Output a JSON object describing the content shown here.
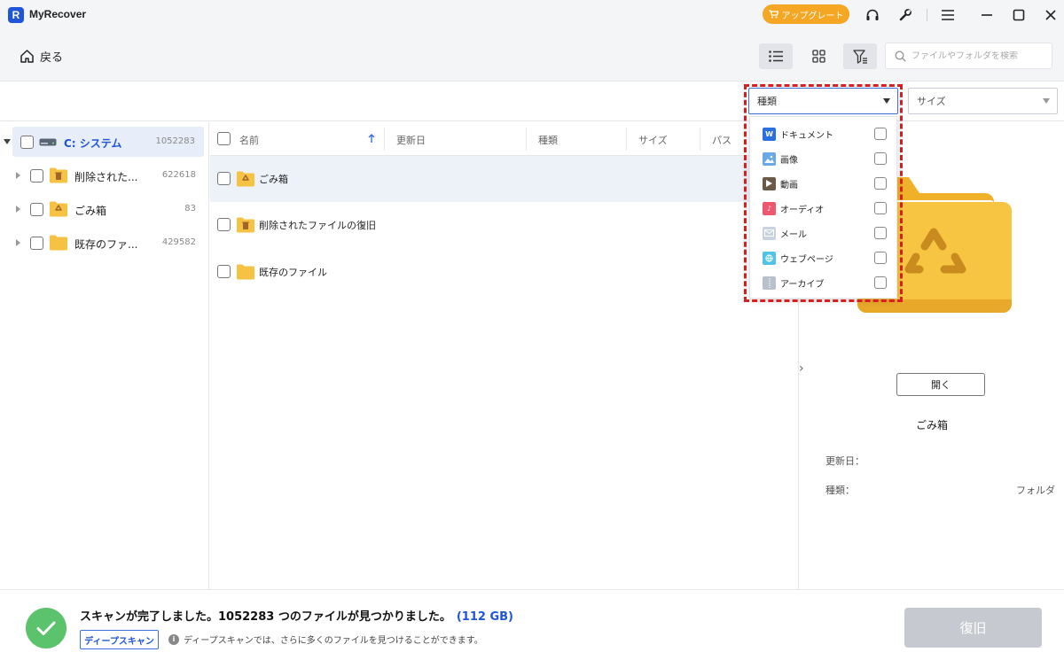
{
  "app": {
    "title": "MyRecover",
    "logo_letter": "R"
  },
  "titlebar": {
    "upgrade_label": "アップグレート"
  },
  "toolbar": {
    "back_label": "戻る",
    "search_placeholder": "ファイルやフォルダを検索"
  },
  "filters": {
    "type_label": "種類",
    "size_label": "サイズ"
  },
  "type_dropdown": {
    "items": [
      {
        "label": "ドキュメント",
        "icon": "document-icon",
        "color": "#2b6fe0"
      },
      {
        "label": "画像",
        "icon": "image-icon",
        "color": "#6aa9e8"
      },
      {
        "label": "動画",
        "icon": "video-icon",
        "color": "#6b5a4a"
      },
      {
        "label": "オーディオ",
        "icon": "audio-icon",
        "color": "#f0566e"
      },
      {
        "label": "メール",
        "icon": "mail-icon",
        "color": "#c9d3e0"
      },
      {
        "label": "ウェブページ",
        "icon": "webpage-icon",
        "color": "#4fc4e8"
      },
      {
        "label": "アーカイブ",
        "icon": "archive-icon",
        "color": "#b8c0cc"
      }
    ]
  },
  "tree": {
    "root": {
      "label": "C: システム",
      "count": "1052283"
    },
    "children": [
      {
        "label": "削除された...",
        "count": "622618",
        "icon": "deleted-folder-icon"
      },
      {
        "label": "ごみ箱",
        "count": "83",
        "icon": "recycle-folder-icon"
      },
      {
        "label": "既存のファ...",
        "count": "429582",
        "icon": "folder-icon"
      }
    ]
  },
  "list": {
    "columns": [
      "名前",
      "更新日",
      "種類",
      "サイズ",
      "パス"
    ],
    "rows": [
      {
        "name": "ごみ箱",
        "icon": "recycle-folder-icon"
      },
      {
        "name": "削除されたファイルの復旧",
        "icon": "deleted-folder-icon"
      },
      {
        "name": "既存のファイル",
        "icon": "folder-icon"
      }
    ]
  },
  "preview": {
    "open_label": "開く",
    "name": "ごみ箱",
    "modified_label": "更新日：",
    "modified_value": "",
    "type_label": "種類：",
    "type_value": "フォルダ"
  },
  "status": {
    "main_text": "スキャンが完了しました。1052283 つのファイルが見つかりました。",
    "size_text": "(112 GB)",
    "deep_scan_label": "ディープスキャン",
    "hint_text": "ディープスキャンでは、さらに多くのファイルを見つけることができます。",
    "recover_label": "復旧"
  },
  "colors": {
    "accent": "#1f55d6",
    "upgrade": "#f5a623",
    "success": "#5bc36b",
    "highlight": "#d81e1e"
  }
}
